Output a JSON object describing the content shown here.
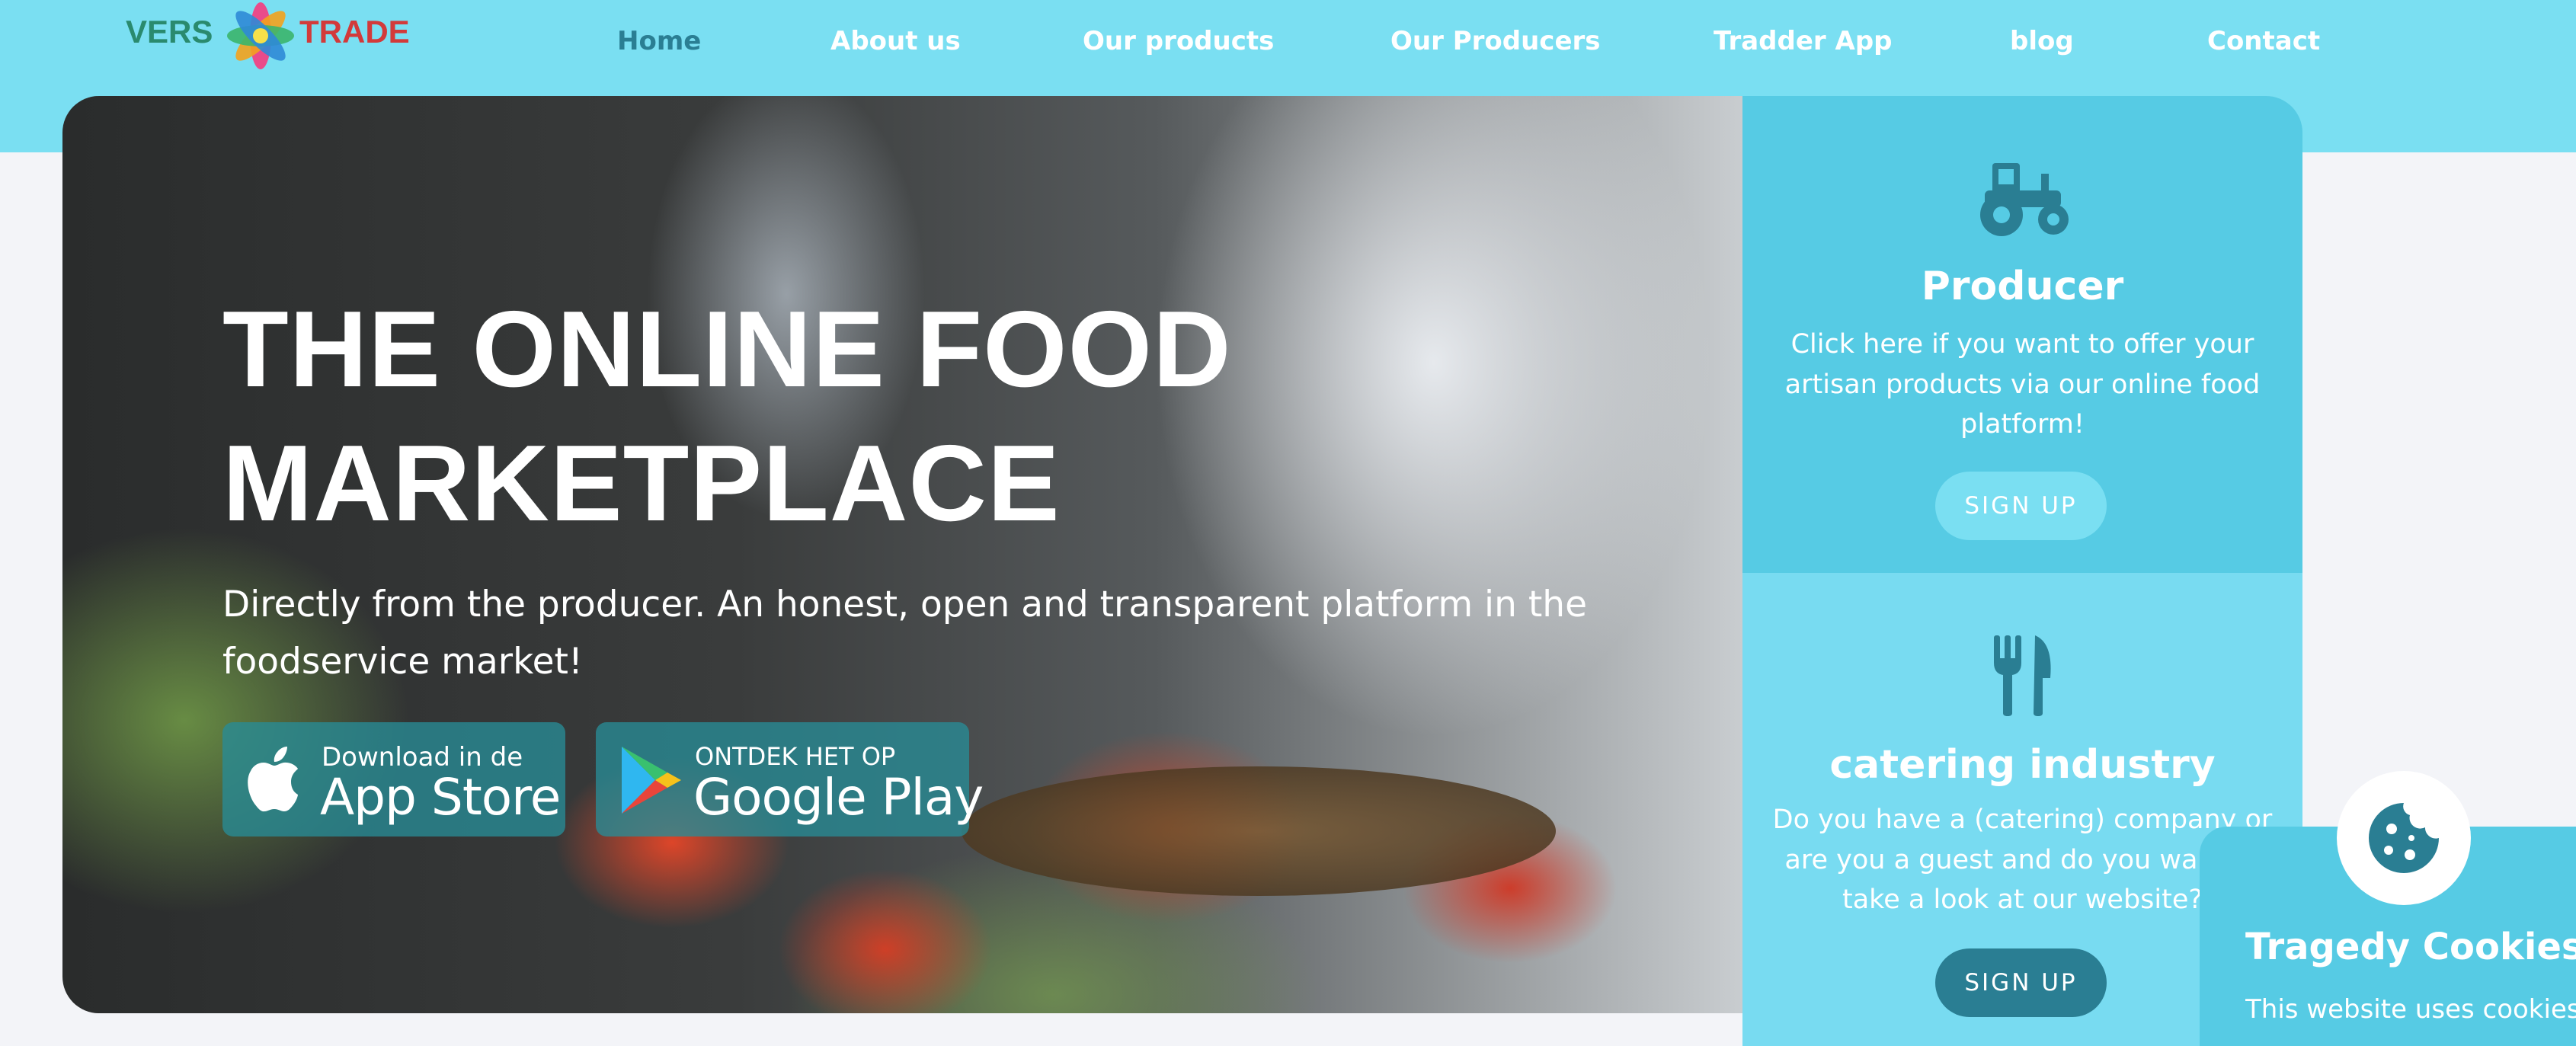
{
  "logo": {
    "part1": "VERS",
    "part2": "TRADE"
  },
  "nav": {
    "items": [
      "Home",
      "About us",
      "Our products",
      "Our Producers",
      "Tradder App",
      "blog",
      "Contact"
    ],
    "active_color": "#2a7e93"
  },
  "hero": {
    "title_line1": "THE ONLINE FOOD",
    "title_line2": "MARKETPLACE",
    "subtitle": "Directly from the producer. An honest, open and transparent platform in the foodservice market!",
    "app_store": {
      "small": "Download in de",
      "big": "App Store",
      "icon": "apple-icon"
    },
    "google_play": {
      "small": "ONTDEK HET OP",
      "big": "Google Play",
      "icon": "google-play-icon"
    }
  },
  "producer_card": {
    "icon": "tractor-icon",
    "title": "Producer",
    "text": "Click here if you want to offer your artisan products via our online food platform!",
    "button": "SIGN UP"
  },
  "catering_card": {
    "icon": "fork-knife-icon",
    "title": "catering industry",
    "text": "Do you have a (catering) company or are you a guest and do you want to take a look at our website?",
    "button": "SIGN UP"
  },
  "cookie": {
    "icon": "cookie-icon",
    "title": "Tragedy Cookies",
    "text": "This website uses cookies"
  },
  "colors": {
    "header": "#7adff2",
    "primary_card": "#56cbe4",
    "dark_button": "#2a7e93",
    "page_bg": "#f3f4f8"
  }
}
